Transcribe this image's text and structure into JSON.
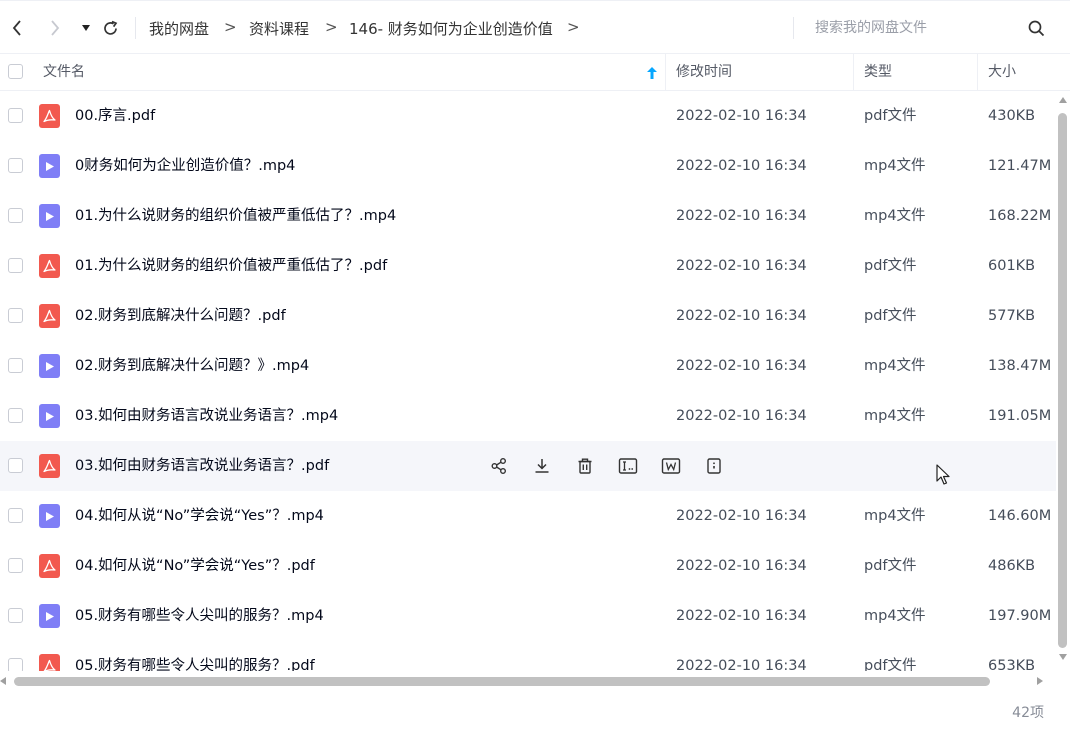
{
  "toolbar": {
    "back_icon": "chevron-left-icon",
    "forward_icon": "chevron-right-icon",
    "history_icon": "caret-down-icon",
    "refresh_icon": "refresh-icon",
    "breadcrumb": [
      "我的网盘",
      "资料课程",
      "146- 财务如何为企业创造价值"
    ],
    "breadcrumb_separator": ">",
    "search_placeholder": "搜索我的网盘文件",
    "search_icon": "search-icon"
  },
  "columns": {
    "name": "文件名",
    "modified": "修改时间",
    "type": "类型",
    "size": "大小",
    "sort_icon": "sort-up-arrow-icon"
  },
  "files": [
    {
      "name": "00.序言.pdf",
      "kind": "pdf",
      "date": "2022-02-10 16:34",
      "type": "pdf文件",
      "size": "430KB"
    },
    {
      "name": "0财务如何为企业创造价值？.mp4",
      "kind": "mp4",
      "date": "2022-02-10 16:34",
      "type": "mp4文件",
      "size": "121.47M"
    },
    {
      "name": "01.为什么说财务的组织价值被严重低估了？.mp4",
      "kind": "mp4",
      "date": "2022-02-10 16:34",
      "type": "mp4文件",
      "size": "168.22M"
    },
    {
      "name": "01.为什么说财务的组织价值被严重低估了？.pdf",
      "kind": "pdf",
      "date": "2022-02-10 16:34",
      "type": "pdf文件",
      "size": "601KB"
    },
    {
      "name": "02.财务到底解决什么问题？.pdf",
      "kind": "pdf",
      "date": "2022-02-10 16:34",
      "type": "pdf文件",
      "size": "577KB"
    },
    {
      "name": "02.财务到底解决什么问题？》.mp4",
      "kind": "mp4",
      "date": "2022-02-10 16:34",
      "type": "mp4文件",
      "size": "138.47M"
    },
    {
      "name": "03.如何由财务语言改说业务语言？.mp4",
      "kind": "mp4",
      "date": "2022-02-10 16:34",
      "type": "mp4文件",
      "size": "191.05M"
    },
    {
      "name": "03.如何由财务语言改说业务语言？.pdf",
      "kind": "pdf",
      "date": "",
      "type": "",
      "size": "",
      "hovered": true
    },
    {
      "name": "04.如何从说“No”学会说“Yes”？.mp4",
      "kind": "mp4",
      "date": "2022-02-10 16:34",
      "type": "mp4文件",
      "size": "146.60M"
    },
    {
      "name": "04.如何从说“No”学会说“Yes”？.pdf",
      "kind": "pdf",
      "date": "2022-02-10 16:34",
      "type": "pdf文件",
      "size": "486KB"
    },
    {
      "name": "05.财务有哪些令人尖叫的服务？.mp4",
      "kind": "mp4",
      "date": "2022-02-10 16:34",
      "type": "mp4文件",
      "size": "197.90M"
    },
    {
      "name": "05.财务有哪些令人尖叫的服务？.pdf",
      "kind": "pdf",
      "date": "2022-02-10 16:34",
      "type": "pdf文件",
      "size": "653KB"
    }
  ],
  "row_actions": [
    "share-icon",
    "download-icon",
    "delete-icon",
    "rename-icon",
    "word-convert-icon",
    "more-icon"
  ],
  "status": {
    "count": "42项"
  },
  "colors": {
    "accent": "#06a7ff",
    "pdf_icon": "#f2594f",
    "mp4_icon": "#7f7ef6",
    "hover_row": "#f5f6fa"
  }
}
